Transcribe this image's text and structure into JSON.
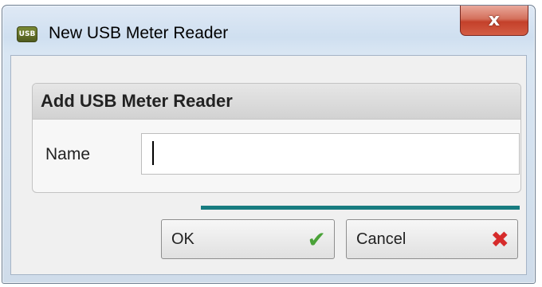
{
  "window": {
    "title": "New USB Meter Reader",
    "app_icon_text": "USB",
    "close_glyph": "x"
  },
  "group": {
    "title": "Add USB Meter Reader"
  },
  "form": {
    "name_label": "Name",
    "name_value": "",
    "name_placeholder": ""
  },
  "progress": {
    "fraction": 1.0,
    "color": "#177c80"
  },
  "buttons": {
    "ok_label": "OK",
    "ok_icon": "check-icon",
    "cancel_label": "Cancel",
    "cancel_icon": "x-icon"
  }
}
